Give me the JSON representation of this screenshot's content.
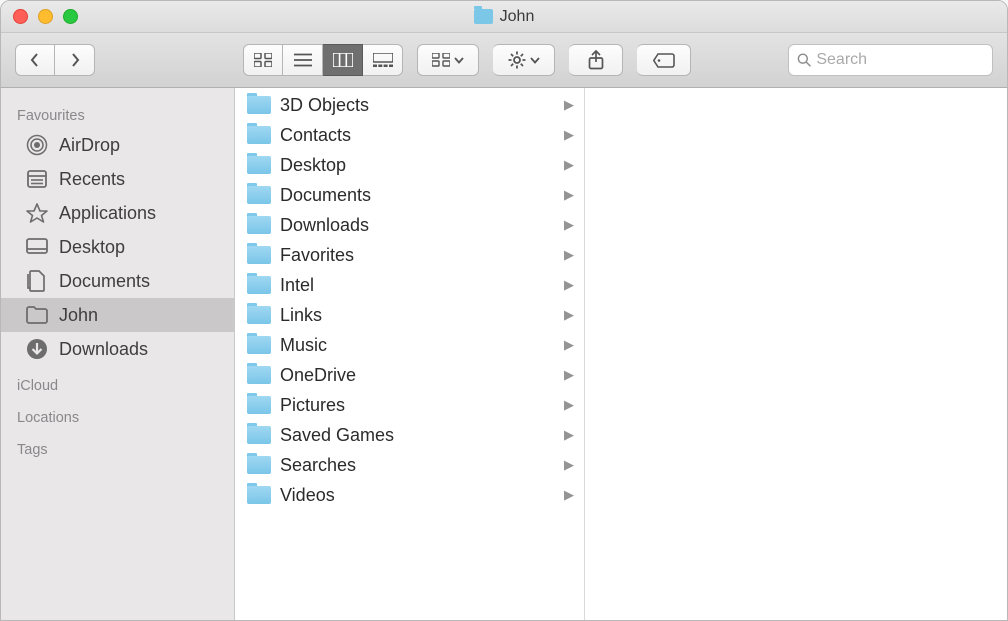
{
  "window": {
    "title": "John"
  },
  "search": {
    "placeholder": "Search"
  },
  "sidebar": {
    "sections": {
      "favourites": {
        "heading": "Favourites",
        "items": [
          {
            "label": "AirDrop",
            "icon": "airdrop"
          },
          {
            "label": "Recents",
            "icon": "recents"
          },
          {
            "label": "Applications",
            "icon": "applications"
          },
          {
            "label": "Desktop",
            "icon": "desktop"
          },
          {
            "label": "Documents",
            "icon": "documents"
          },
          {
            "label": "John",
            "icon": "folder",
            "selected": true
          },
          {
            "label": "Downloads",
            "icon": "downloads"
          }
        ]
      },
      "icloud": {
        "heading": "iCloud"
      },
      "locations": {
        "heading": "Locations"
      },
      "tags": {
        "heading": "Tags"
      }
    }
  },
  "column": {
    "items": [
      {
        "label": "3D Objects"
      },
      {
        "label": "Contacts"
      },
      {
        "label": "Desktop"
      },
      {
        "label": "Documents"
      },
      {
        "label": "Downloads"
      },
      {
        "label": "Favorites"
      },
      {
        "label": "Intel"
      },
      {
        "label": "Links"
      },
      {
        "label": "Music"
      },
      {
        "label": "OneDrive"
      },
      {
        "label": "Pictures"
      },
      {
        "label": "Saved Games"
      },
      {
        "label": "Searches"
      },
      {
        "label": "Videos"
      }
    ]
  }
}
